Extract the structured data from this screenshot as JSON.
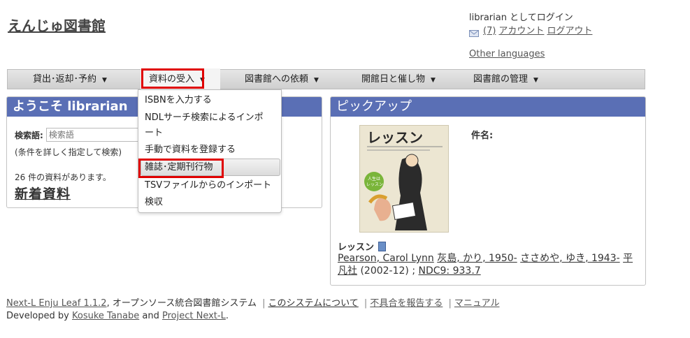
{
  "site_title": "えんじゅ図書館",
  "user": {
    "login_text": "librarian としてログイン",
    "message_count": "(7)",
    "account_link": "アカウント",
    "logout_link": "ログアウト",
    "other_languages": "Other languages"
  },
  "nav": {
    "items": [
      {
        "label": "貸出･返却･予約"
      },
      {
        "label": "資料の受入"
      },
      {
        "label": "図書館への依頼"
      },
      {
        "label": "開館日と催し物"
      },
      {
        "label": "図書館の管理"
      }
    ],
    "caret": "▼"
  },
  "dropdown": {
    "items": [
      {
        "label": "ISBNを入力する"
      },
      {
        "label": "NDLサーチ検索によるインポ"
      },
      {
        "label": "ート"
      },
      {
        "label": "手動で資料を登録する"
      },
      {
        "label": "雑誌･定期刊行物"
      },
      {
        "label": "TSVファイルからのインポート"
      },
      {
        "label": "検収"
      }
    ]
  },
  "welcome": {
    "title": "ようこそ librarian",
    "search_label": "検索語:",
    "search_placeholder": "検索語",
    "adv_open": "(",
    "adv_link": "条件を詳しく指定して検索",
    "adv_close": ")",
    "count_text": "26 件の資料があります。",
    "new_books": "新着資料"
  },
  "pickup": {
    "title": "ピックアップ",
    "field_label": "件名:",
    "cover_title": "レッスン",
    "cover_badge": "人生はレッスン",
    "book_title": "レッスン",
    "creators": [
      "Pearson, Carol Lynn",
      "灰島, かり, 1950-",
      "ささめや, ゆき, 1943-"
    ],
    "publisher": "平凡社",
    "date": "(2002-12) ;",
    "ndc": "NDC9: 933.7"
  },
  "footer": {
    "product_link": "Next-L Enju Leaf 1.1.2",
    "product_desc": ", オープンソース統合図書館システム",
    "about_link": "このシステムについて",
    "report_link": "不具合を報告する",
    "manual_link": "マニュアル",
    "developed_by": "Developed by",
    "dev1": "Kosuke Tanabe",
    "and": "and",
    "dev2": "Project Next-L",
    "period": "."
  },
  "colors": {
    "panel_header": "#5a6fb5",
    "highlight": "#e00000"
  }
}
